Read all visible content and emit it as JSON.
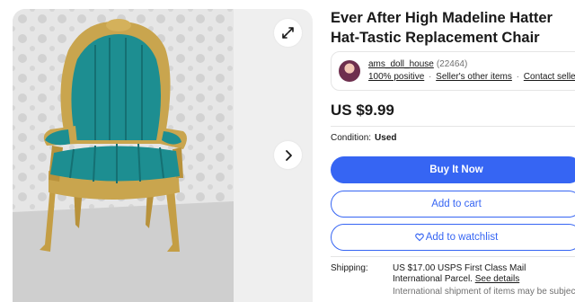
{
  "listing": {
    "title": "Ever After High Madeline Hatter Hat-Tastic Replacement Chair",
    "price": "US $9.99",
    "condition_label": "Condition:",
    "condition_value": "Used"
  },
  "seller": {
    "name": "ams_doll_house",
    "feedback_count": "(22464)",
    "positive": "100% positive",
    "other_items": "Seller's other items",
    "contact": "Contact seller",
    "separator": "·"
  },
  "actions": {
    "buy_now": "Buy It Now",
    "add_to_cart": "Add to cart",
    "watchlist": "Add to watchlist",
    "watchlist_icon": "heart-icon"
  },
  "shipping": {
    "label": "Shipping:",
    "text": "US $17.00 USPS First Class Mail International Parcel.",
    "details_link": "See details",
    "note": "International shipment of items may be subject"
  },
  "gallery": {
    "expand_icon": "expand-icon",
    "next_icon": "chevron-right-icon"
  },
  "colors": {
    "accent": "#3665f3",
    "chair_frame": "#c9a54e",
    "chair_upholstery": "#1d8e91"
  }
}
